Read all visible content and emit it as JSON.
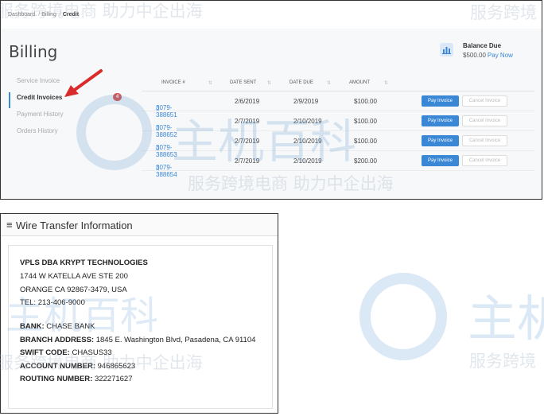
{
  "breadcrumb": [
    "Dashboard",
    "Billing",
    "Credit"
  ],
  "page_title": "Billing",
  "balance": {
    "title": "Balance Due",
    "amount": "$500.00",
    "pay_link": "Pay Now"
  },
  "side_nav": [
    {
      "label": "Service Invoice",
      "active": false
    },
    {
      "label": "Credit Invoices",
      "active": true,
      "badge": "4"
    },
    {
      "label": "Payment History",
      "active": false
    },
    {
      "label": "Orders History",
      "active": false
    }
  ],
  "table": {
    "columns": [
      "INVOICE #",
      "DATE SENT",
      "DATE DUE",
      "AMOUNT"
    ],
    "rows": [
      {
        "invoice": "3079-388651",
        "sent": "2/6/2019",
        "due": "2/9/2019",
        "amount": "$100.00"
      },
      {
        "invoice": "3079-388652",
        "sent": "2/7/2019",
        "due": "2/10/2019",
        "amount": "$100.00"
      },
      {
        "invoice": "3079-388653",
        "sent": "2/7/2019",
        "due": "2/10/2019",
        "amount": "$100.00"
      },
      {
        "invoice": "3079-388654",
        "sent": "2/7/2019",
        "due": "2/10/2019",
        "amount": "$200.00"
      }
    ],
    "pay_label": "Pay Invoice",
    "cancel_label": "Cancel Invoice"
  },
  "wire": {
    "title": "Wire Transfer Information",
    "company": "VPLS DBA KRYPT TECHNOLOGIES",
    "address1": "1744 W KATELLA AVE STE 200",
    "address2": "ORANGE CA 92867-3479, USA",
    "tel": "TEL: 213-406-9000",
    "bank_label": "BANK:",
    "bank_value": "CHASE BANK",
    "branch_label": "BRANCH ADDRESS:",
    "branch_value": "1845 E. Washington Blvd, Pasadena, CA 91104",
    "swift_label": "SWIFT CODE:",
    "swift_value": "CHASUS33",
    "account_label": "ACCOUNT NUMBER:",
    "account_value": "946865623",
    "routing_label": "ROUTING NUMBER:",
    "routing_value": "322271627"
  },
  "watermark": {
    "slogan": "服务跨境电商 助力中企出海",
    "brand_short": "服务跨境",
    "brand_zh": "主机百科",
    "slogan_right": "服务跨境"
  },
  "colors": {
    "accent": "#3a87d6",
    "badge": "#d9534f",
    "arrow": "#d92b2b"
  }
}
